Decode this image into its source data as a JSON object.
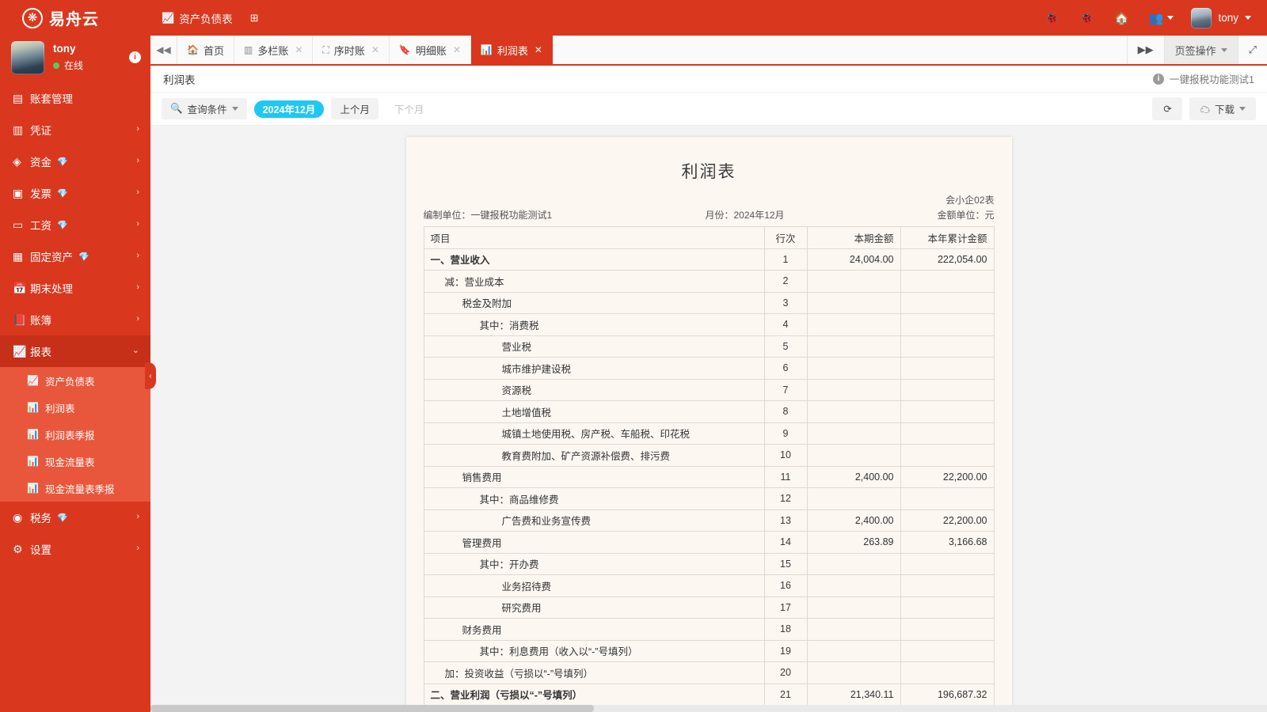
{
  "brand": {
    "name": "易舟云",
    "logo_icon": "flower-seal-icon"
  },
  "topnav": [
    {
      "label": "资产负债表",
      "icon": "chart-area-icon"
    },
    {
      "label": "",
      "icon": "grid-plus-icon"
    }
  ],
  "topbar_right": {
    "icons": [
      "bug-icon",
      "bug-icon",
      "home-icon",
      "user-group-icon"
    ],
    "user": "tony"
  },
  "sidebar": {
    "profile": {
      "name": "tony",
      "status": "在线",
      "info_badge": "i",
      "avatar": "user-avatar"
    },
    "items": [
      {
        "label": "账套管理",
        "icon": "book-cover-icon",
        "gem": false,
        "arrow": ""
      },
      {
        "label": "凭证",
        "icon": "voucher-icon",
        "gem": false,
        "arrow": "›"
      },
      {
        "label": "资金",
        "icon": "coins-icon",
        "gem": true,
        "arrow": "›"
      },
      {
        "label": "发票",
        "icon": "invoice-icon",
        "gem": true,
        "arrow": "›"
      },
      {
        "label": "工资",
        "icon": "card-icon",
        "gem": true,
        "arrow": "›"
      },
      {
        "label": "固定资产",
        "icon": "building-icon",
        "gem": true,
        "arrow": "›"
      },
      {
        "label": "期末处理",
        "icon": "calendar-icon",
        "gem": false,
        "arrow": "›"
      },
      {
        "label": "账簿",
        "icon": "ledger-icon",
        "gem": false,
        "arrow": "›"
      },
      {
        "label": "报表",
        "icon": "chart-line-icon",
        "gem": false,
        "arrow": "⌄",
        "active": true
      }
    ],
    "submenu": [
      {
        "label": "资产负债表",
        "icon": "chart-area-icon"
      },
      {
        "label": "利润表",
        "icon": "chart-bar-icon"
      },
      {
        "label": "利润表季报",
        "icon": "chart-bar-icon"
      },
      {
        "label": "现金流量表",
        "icon": "chart-bar-icon"
      },
      {
        "label": "现金流量表季报",
        "icon": "chart-bar-icon"
      }
    ],
    "items_after": [
      {
        "label": "税务",
        "icon": "tax-circle-icon",
        "gem": true,
        "arrow": "›"
      },
      {
        "label": "设置",
        "icon": "gear-icon",
        "gem": false,
        "arrow": "›"
      }
    ],
    "collapse_handle": "‹"
  },
  "tabstrip": {
    "scroll_left_icon": "double-chevron-left-icon",
    "tabs": [
      {
        "label": "首页",
        "icon": "home-icon",
        "closable": false,
        "active": false
      },
      {
        "label": "多栏账",
        "icon": "columns-icon",
        "closable": true,
        "active": false
      },
      {
        "label": "序时账",
        "icon": "crop-icon",
        "closable": true,
        "active": false
      },
      {
        "label": "明细账",
        "icon": "bookmark-icon",
        "closable": true,
        "active": false
      },
      {
        "label": "利润表",
        "icon": "chart-bar-icon",
        "closable": true,
        "active": true
      }
    ],
    "scroll_right_icon": "double-chevron-right-icon",
    "tab_ops_label": "页签操作",
    "fullscreen_icon": "expand-icon"
  },
  "breadcrumb": {
    "title": "利润表",
    "company": "一键报税功能测试1",
    "info_icon": "info-icon"
  },
  "toolbar": {
    "query_label": "查询条件",
    "query_icon": "search-icon",
    "period_badge": "2024年12月",
    "prev_month": "上个月",
    "next_month": "下个月",
    "refresh_icon": "refresh-icon",
    "download_label": "下载",
    "download_icon": "cloud-download-icon"
  },
  "report": {
    "title": "利润表",
    "form_code": "会小企02表",
    "amount_unit": "金额单位：元",
    "preparer_label": "编制单位：一键报税功能测试1",
    "month_label": "月份：2024年12月",
    "columns": [
      "项目",
      "行次",
      "本期金额",
      "本年累计金额"
    ],
    "rows": [
      {
        "level": 0,
        "item": "一、营业收入",
        "line": "1",
        "current": "24,004.00",
        "ytd": "222,054.00"
      },
      {
        "level": 1,
        "item": "减：营业成本",
        "line": "2",
        "current": "",
        "ytd": ""
      },
      {
        "level": 2,
        "item": "税金及附加",
        "line": "3",
        "current": "",
        "ytd": ""
      },
      {
        "level": 3,
        "item": "其中：消费税",
        "line": "4",
        "current": "",
        "ytd": ""
      },
      {
        "level": 4,
        "item": "营业税",
        "line": "5",
        "current": "",
        "ytd": ""
      },
      {
        "level": 4,
        "item": "城市维护建设税",
        "line": "6",
        "current": "",
        "ytd": ""
      },
      {
        "level": 4,
        "item": "资源税",
        "line": "7",
        "current": "",
        "ytd": ""
      },
      {
        "level": 4,
        "item": "土地增值税",
        "line": "8",
        "current": "",
        "ytd": ""
      },
      {
        "level": 4,
        "item": "城镇土地使用税、房产税、车船税、印花税",
        "line": "9",
        "current": "",
        "ytd": ""
      },
      {
        "level": 4,
        "item": "教育费附加、矿产资源补偿费、排污费",
        "line": "10",
        "current": "",
        "ytd": ""
      },
      {
        "level": 2,
        "item": "销售费用",
        "line": "11",
        "current": "2,400.00",
        "ytd": "22,200.00"
      },
      {
        "level": 3,
        "item": "其中：商品维修费",
        "line": "12",
        "current": "",
        "ytd": ""
      },
      {
        "level": 4,
        "item": "广告费和业务宣传费",
        "line": "13",
        "current": "2,400.00",
        "ytd": "22,200.00"
      },
      {
        "level": 2,
        "item": "管理费用",
        "line": "14",
        "current": "263.89",
        "ytd": "3,166.68"
      },
      {
        "level": 3,
        "item": "其中：开办费",
        "line": "15",
        "current": "",
        "ytd": ""
      },
      {
        "level": 4,
        "item": "业务招待费",
        "line": "16",
        "current": "",
        "ytd": ""
      },
      {
        "level": 4,
        "item": "研究费用",
        "line": "17",
        "current": "",
        "ytd": ""
      },
      {
        "level": 2,
        "item": "财务费用",
        "line": "18",
        "current": "",
        "ytd": ""
      },
      {
        "level": 3,
        "item": "其中：利息费用（收入以“-”号填列）",
        "line": "19",
        "current": "",
        "ytd": ""
      },
      {
        "level": 1,
        "item": "加：投资收益（亏损以“-”号填列）",
        "line": "20",
        "current": "",
        "ytd": ""
      },
      {
        "level": 0,
        "item": "二、营业利润（亏损以“-”号填列）",
        "line": "21",
        "current": "21,340.11",
        "ytd": "196,687.32"
      }
    ]
  },
  "colors": {
    "brand_red": "#d9381e",
    "submenu_red": "#e8573c",
    "active_red": "#c62f18",
    "period_cyan": "#1fc8f0",
    "paper_bg": "#fdf7f2",
    "online_green": "#5ec75e"
  }
}
